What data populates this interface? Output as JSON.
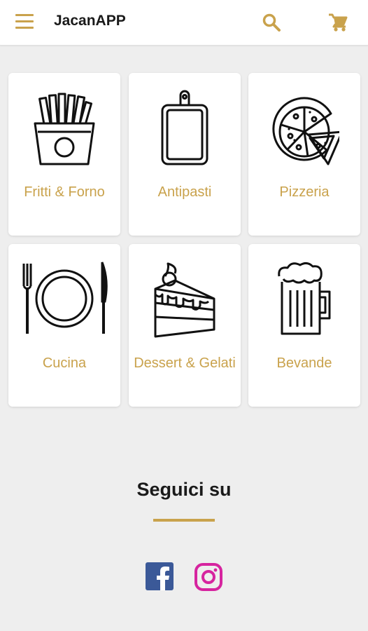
{
  "header": {
    "title": "JacanAPP",
    "accent_color": "#c9a24c",
    "menu_icon": "hamburger-menu-icon",
    "search_icon": "search-icon",
    "cart_icon": "shopping-cart-icon"
  },
  "categories": [
    {
      "label": "Fritti & Forno",
      "icon": "french-fries-icon"
    },
    {
      "label": "Antipasti",
      "icon": "cutting-board-icon"
    },
    {
      "label": "Pizzeria",
      "icon": "pizza-icon"
    },
    {
      "label": "Cucina",
      "icon": "plate-fork-knife-icon"
    },
    {
      "label": "Dessert & Gelati",
      "icon": "cake-slice-icon"
    },
    {
      "label": "Bevande",
      "icon": "beer-mug-icon"
    }
  ],
  "follow": {
    "title": "Seguici su",
    "socials": [
      {
        "name": "Facebook",
        "icon": "facebook-icon",
        "color": "#3b5998"
      },
      {
        "name": "Instagram",
        "icon": "instagram-icon",
        "color": "#d6249f"
      }
    ]
  }
}
